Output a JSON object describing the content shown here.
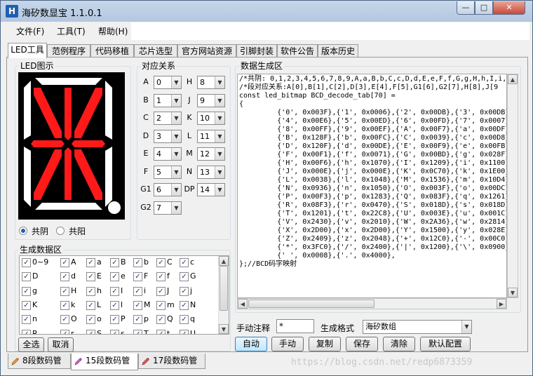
{
  "window": {
    "title": "海矽数显宝 1.1.0.1",
    "icon": "H",
    "controls": {
      "minimize": "—",
      "maximize": "□",
      "close": "✕"
    }
  },
  "menu": [
    "文件(F)",
    "工具(T)",
    "帮助(H)"
  ],
  "tabs": [
    "LED工具",
    "范例程序",
    "代码移植",
    "芯片选型",
    "官方网站资源",
    "引脚封装",
    "软件公告",
    "版本历史"
  ],
  "led_group": {
    "label": "LED图示",
    "segment_on_color": "#ff1a1a",
    "segment_off_color": "#ffffff",
    "radio_common_cathode": "共阴",
    "radio_common_anode": "共阳"
  },
  "mapping_group": {
    "label": "对应关系",
    "rows": [
      {
        "a": "A",
        "av": "0",
        "b": "H",
        "bv": "8"
      },
      {
        "a": "B",
        "av": "1",
        "b": "J",
        "bv": "9"
      },
      {
        "a": "C",
        "av": "2",
        "b": "K",
        "bv": "10"
      },
      {
        "a": "D",
        "av": "3",
        "b": "L",
        "bv": "11"
      },
      {
        "a": "E",
        "av": "4",
        "b": "M",
        "bv": "12"
      },
      {
        "a": "F",
        "av": "5",
        "b": "N",
        "bv": "13"
      },
      {
        "a": "G1",
        "av": "6",
        "b": "DP",
        "bv": "14"
      },
      {
        "a": "G2",
        "av": "7"
      }
    ]
  },
  "gen_group": {
    "label": "生成数据区",
    "rows": [
      [
        "0~9",
        "A",
        "a",
        "B",
        "b",
        "C",
        "c"
      ],
      [
        "D",
        "d",
        "E",
        "e",
        "F",
        "f",
        "G"
      ],
      [
        "g",
        "H",
        "h",
        "I",
        "i",
        "J",
        "j"
      ],
      [
        "K",
        "k",
        "L",
        "l",
        "M",
        "m",
        "N"
      ],
      [
        "n",
        "O",
        "o",
        "P",
        "p",
        "Q",
        "q"
      ],
      [
        "R",
        "r",
        "S",
        "s",
        "T",
        "t",
        "U"
      ]
    ],
    "select_all": "全选",
    "cancel": "取消"
  },
  "output_group": {
    "label": "数据生成区",
    "code": "/*共阴: 0,1,2,3,4,5,6,7,8,9,A,a,B,b,C,c,D,d,E,e,F,f,G,g,H,h,I,i,J,j\n/*段对应关系:A[0],B[1],C[2],D[3],E[4],F[5],G1[6],G2[7],H[8],J[9\nconst led_bitmap BCD_decode_tab[70] =\n{\n         {'0', 0x003F},{'1', 0x0006},{'2', 0x00DB},{'3', 0x00DB},\n         {'4', 0x00E6},{'5', 0x00ED},{'6', 0x00FD},{'7', 0x0007},\n         {'8', 0x00FF},{'9', 0x00EF},{'A', 0x00F7},{'a', 0x00DF},\n         {'B', 0x128F},{'b', 0x00FC},{'C', 0x0039},{'c', 0x00D8},\n         {'D', 0x120F},{'d', 0x00DE},{'E', 0x00F9},{'e', 0x00FB},\n         {'F', 0x00F1},{'f', 0x0071},{'G', 0x00BD},{'g', 0x028F},\n         {'H', 0x00F6},{'h', 0x1070},{'I', 0x1209},{'i', 0x1100},\n         {'J', 0x000E},{'j', 0x000E},{'K', 0x0C70},{'k', 0x1E00},\n         {'L', 0x0038},{'l', 0x1048},{'M', 0x1536},{'m', 0x10D4},\n         {'N', 0x0936},{'n', 0x1050},{'O', 0x003F},{'o', 0x00DC},\n         {'P', 0x00F3},{'p', 0x1283},{'Q', 0x083F},{'q', 0x1261},\n         {'R', 0x08F3},{'r', 0x0470},{'S', 0x018D},{'s', 0x018D},\n         {'T', 0x1201},{'t', 0x22C8},{'U', 0x003E},{'u', 0x001C},\n         {'V', 0x2430},{'v', 0x2010},{'W', 0x2A36},{'w', 0x2814},\n         {'X', 0x2D00},{'x', 0x2D00},{'Y', 0x1500},{'y', 0x028E},\n         {'Z', 0x2409},{'z', 0x2048},{'+', 0x12C0},{'-', 0x00C0},\n         {'*', 0x3FC0},{'/', 0x2400},{'|', 0x1200},{'\\', 0x0900},\n         {' ', 0x0008},{'.', 0x4000},\n};//BCD码字映射"
  },
  "annotation": {
    "label": "手动注释",
    "value": "*"
  },
  "format": {
    "label": "生成格式",
    "value": "海矽数组"
  },
  "buttons": [
    "自动",
    "手动",
    "复制",
    "保存",
    "清除",
    "默认配置"
  ],
  "bottom_tabs": [
    "8段数码管",
    "15段数码管",
    "17段数码管"
  ],
  "watermark": "https://blog.csdn.net/redp6873359"
}
